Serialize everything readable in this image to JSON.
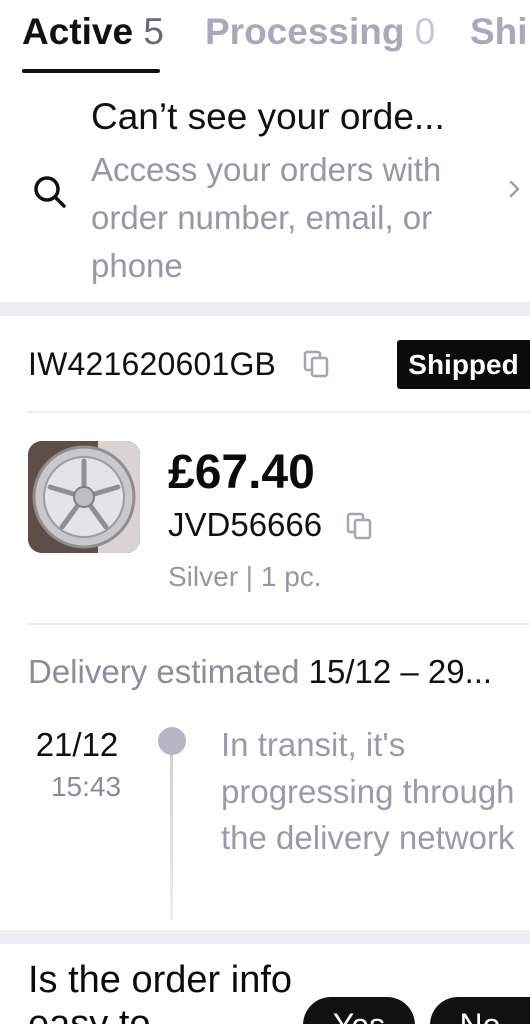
{
  "tabs": [
    {
      "label": "Active",
      "count": "5"
    },
    {
      "label": "Processing",
      "count": "0"
    },
    {
      "label": "Shi",
      "count": ""
    }
  ],
  "find_order": {
    "title": "Can’t see your orde...",
    "description": "Access your orders with order number, email, or phone",
    "icon": "search-icon",
    "chevron": "chevron-right-icon"
  },
  "order": {
    "tracking_number": "IW421620601GB",
    "status": "Shipped",
    "price": "£67.40",
    "sku": "JVD56666",
    "variant": "Silver | 1 pc.",
    "delivery_label": "Delivery estimated",
    "delivery_dates": "15/12 – 29...",
    "timeline": [
      {
        "date": "21/12",
        "time": "15:43",
        "status": "In transit, it's progressing through the delivery network"
      }
    ]
  },
  "feedback": {
    "question": "Is the order info easy to",
    "yes_label": "Yes",
    "no_label": "No"
  },
  "colors": {
    "accent": "#0b0b0b",
    "muted": "#9797a6",
    "divider": "#efeff3"
  }
}
